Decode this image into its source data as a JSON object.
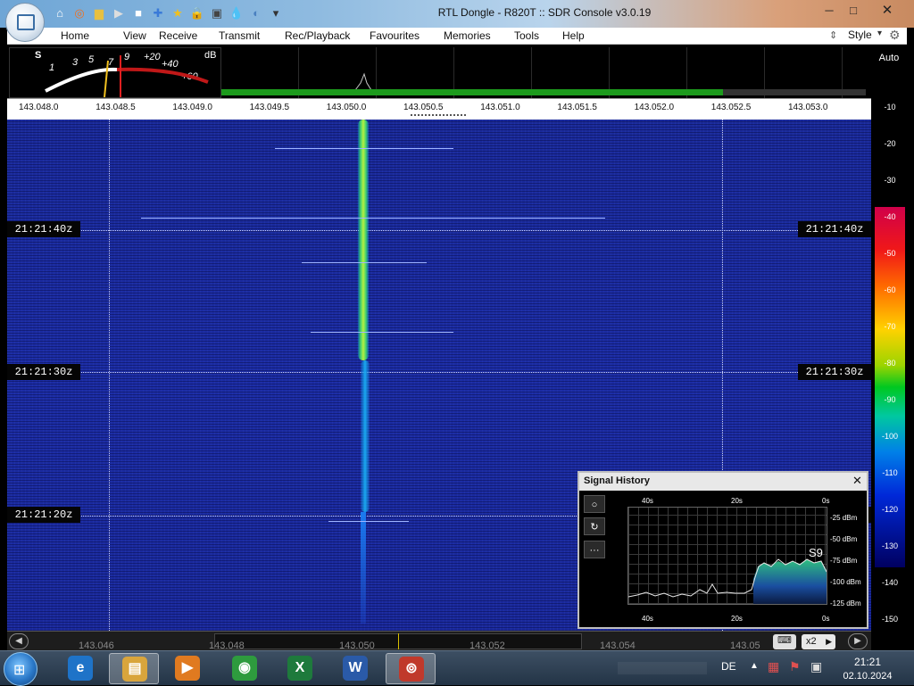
{
  "window": {
    "title": "RTL Dongle - R820T :: SDR Console v3.0.19",
    "minimize": "─",
    "maximize": "□",
    "close": "✕"
  },
  "quick_access": [
    "home-icon",
    "lifebuoy-icon",
    "folder-icon",
    "play-icon",
    "stop-icon",
    "add-icon",
    "star-icon",
    "lock-icon",
    "camera-icon",
    "water-icon",
    "globe-icon",
    "dropdown-icon"
  ],
  "menu": {
    "items": [
      "Home",
      "View",
      "Receive",
      "Transmit",
      "Rec/Playback",
      "Favourites",
      "Memories",
      "Tools",
      "Help"
    ],
    "style_label": "Style"
  },
  "meter": {
    "s_label": "S",
    "db_label": "dB",
    "scale": [
      "1",
      "3",
      "5",
      "7",
      "9",
      "+20",
      "+40",
      "+60"
    ]
  },
  "freq_axis": {
    "labels": [
      "143.048.0",
      "143.048.5",
      "143.049.0",
      "143.049.5",
      "143.050.0",
      "143.050.5",
      "143.051.0",
      "143.051.5",
      "143.052.0",
      "143.052.5",
      "143.053.0"
    ]
  },
  "waterfall": {
    "timestamps": [
      "21:21:40z",
      "21:21:30z",
      "21:21:20z"
    ]
  },
  "color_scale": {
    "auto_label": "Auto",
    "levels": [
      "-10",
      "-20",
      "-30",
      "-40",
      "-50",
      "-60",
      "-70",
      "-80",
      "-90",
      "-100",
      "-110",
      "-120",
      "-130",
      "-140",
      "-150"
    ]
  },
  "signal_history": {
    "title": "Signal History",
    "close": "✕",
    "buttons": [
      "○",
      "↻",
      "···"
    ],
    "time_top": [
      "40s",
      "20s",
      "0s"
    ],
    "time_bottom": [
      "40s",
      "20s",
      "0s"
    ],
    "levels": [
      "-25 dBm",
      "-50 dBm",
      "-75 dBm",
      "-100 dBm",
      "-125 dBm"
    ],
    "s_reading": "S9"
  },
  "bottom_bar": {
    "freqs": [
      "143.046",
      "143.048",
      "143.050",
      "143.052",
      "143.054",
      "143.05"
    ],
    "zoom": "x2"
  },
  "taskbar": {
    "apps": [
      {
        "name": "Internet Explorer",
        "glyph": "e",
        "color": "#1e73c8"
      },
      {
        "name": "Explorer",
        "glyph": "▤",
        "color": "#d9a53c"
      },
      {
        "name": "Media Player",
        "glyph": "▶",
        "color": "#e07a20"
      },
      {
        "name": "Chrome",
        "glyph": "◉",
        "color": "#2e9b3e"
      },
      {
        "name": "Excel",
        "glyph": "X",
        "color": "#1e7a3c"
      },
      {
        "name": "Word",
        "glyph": "W",
        "color": "#2a5aa8"
      },
      {
        "name": "SDR Console",
        "glyph": "⊚",
        "color": "#c0392b"
      }
    ],
    "language": "DE",
    "time": "21:21",
    "date": "02.10.2024"
  }
}
